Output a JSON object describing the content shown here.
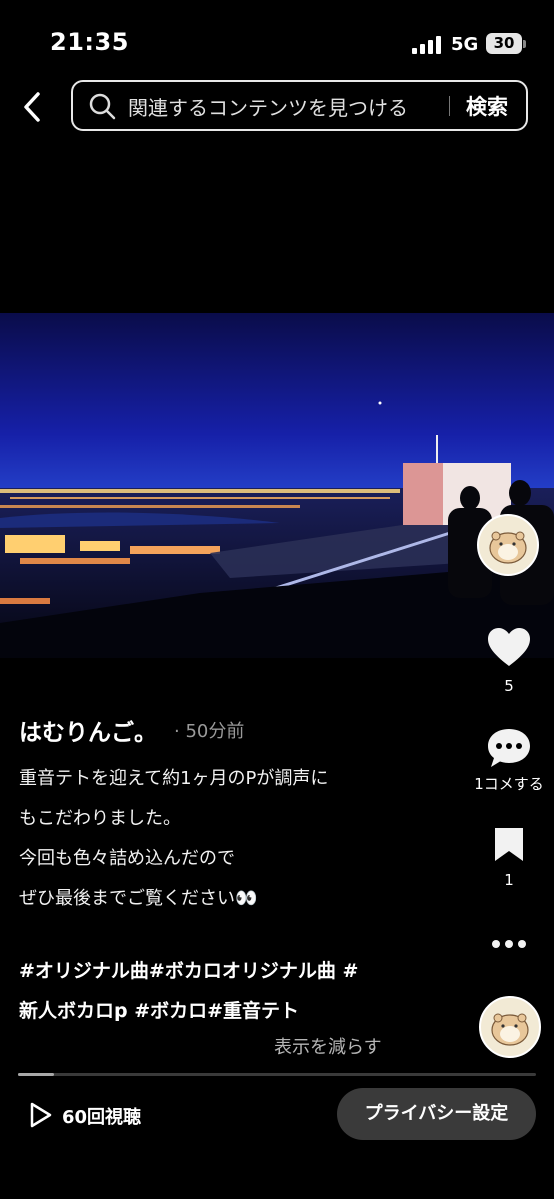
{
  "status_bar": {
    "time": "21:35",
    "network": "5G",
    "battery": "30"
  },
  "search": {
    "placeholder": "関連するコンテンツを見つける",
    "button_label": "検索"
  },
  "rail": {
    "like_count": "5",
    "comment_label": "1コメする",
    "bookmark_count": "1"
  },
  "post": {
    "author": "はむりんご。",
    "time": "· 50分前",
    "caption_lines": [
      "重音テトを迎えて約1ヶ月のPが調声に",
      "もこだわりました。",
      "今回も色々詰め込んだので",
      "ぜひ最後までご覧ください👀"
    ],
    "hashtag_lines": [
      "#オリジナル曲#ボカロオリジナル曲 #",
      "新人ボカロp #ボカロ#重音テト"
    ],
    "show_less": "表示を減らす"
  },
  "playback": {
    "progress": 0.07
  },
  "bottom_bar": {
    "views": "60回視聴",
    "privacy_button": "プライバシー設定"
  },
  "icons": [
    "back-chevron-icon",
    "search-icon",
    "heart-icon",
    "comment-icon",
    "bookmark-icon",
    "more-icon",
    "play-icon"
  ],
  "colors": {
    "background": "#000000",
    "sky_top": "#1a1fb0",
    "button_bg": "#3a3a3a"
  }
}
